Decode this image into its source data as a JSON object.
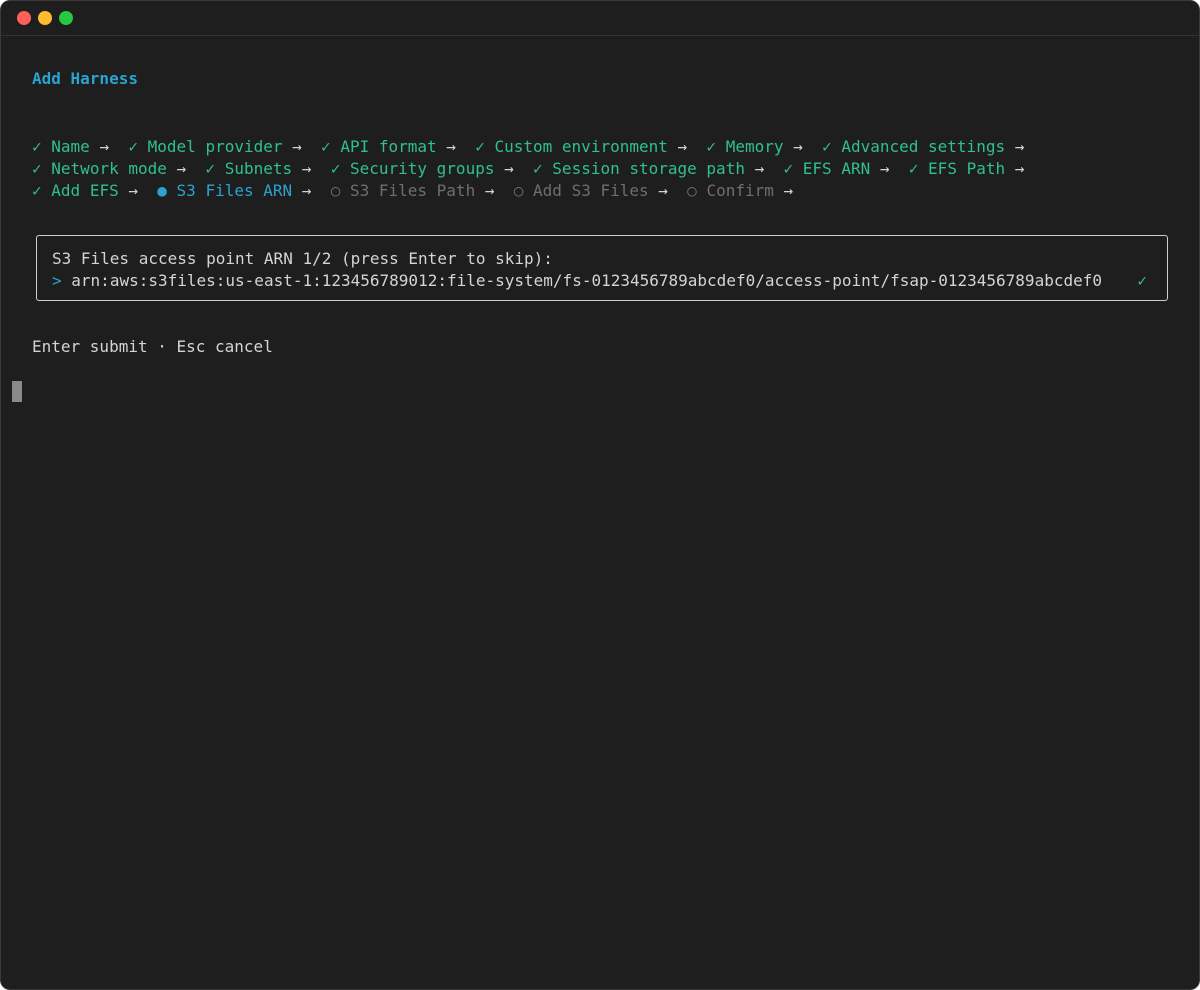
{
  "window": {
    "controls": {
      "close_color": "#ff5f57",
      "minimize_color": "#febc2e",
      "zoom_color": "#28c840"
    }
  },
  "colors": {
    "done": "#2fc08e",
    "active": "#2aa3cf",
    "pending": "#6e6e6e",
    "heading": "#2aa3cf",
    "text": "#d4d4d4",
    "background": "#1e1e1e"
  },
  "heading": "Add Harness",
  "separator": "→",
  "steps": {
    "line1": [
      {
        "icon": "✓",
        "label": "Name",
        "status": "done"
      },
      {
        "icon": "✓",
        "label": "Model provider",
        "status": "done"
      },
      {
        "icon": "✓",
        "label": "API format",
        "status": "done"
      },
      {
        "icon": "✓",
        "label": "Custom environment",
        "status": "done"
      },
      {
        "icon": "✓",
        "label": "Memory",
        "status": "done"
      },
      {
        "icon": "✓",
        "label": "Advanced settings",
        "status": "done"
      }
    ],
    "line2": [
      {
        "icon": "✓",
        "label": "Network mode",
        "status": "done"
      },
      {
        "icon": "✓",
        "label": "Subnets",
        "status": "done"
      },
      {
        "icon": "✓",
        "label": "Security groups",
        "status": "done"
      },
      {
        "icon": "✓",
        "label": "Session storage path",
        "status": "done"
      },
      {
        "icon": "✓",
        "label": "EFS ARN",
        "status": "done"
      },
      {
        "icon": "✓",
        "label": "EFS Path",
        "status": "done"
      }
    ],
    "line3": [
      {
        "icon": "✓",
        "label": "Add EFS",
        "status": "done"
      },
      {
        "icon": "●",
        "label": "S3 Files ARN",
        "status": "active"
      },
      {
        "icon": "○",
        "label": "S3 Files Path",
        "status": "pending"
      },
      {
        "icon": "○",
        "label": "Add S3 Files",
        "status": "pending"
      },
      {
        "icon": "○",
        "label": "Confirm",
        "status": "pending"
      }
    ]
  },
  "prompt": {
    "label": "S3 Files access point ARN 1/2 (press Enter to skip):",
    "caret": ">",
    "value": "arn:aws:s3files:us-east-1:123456789012:file-system/fs-0123456789abcdef0/access-point/fsap-0123456789abcdef0",
    "valid_icon": "✓"
  },
  "hint": "Enter submit · Esc cancel"
}
